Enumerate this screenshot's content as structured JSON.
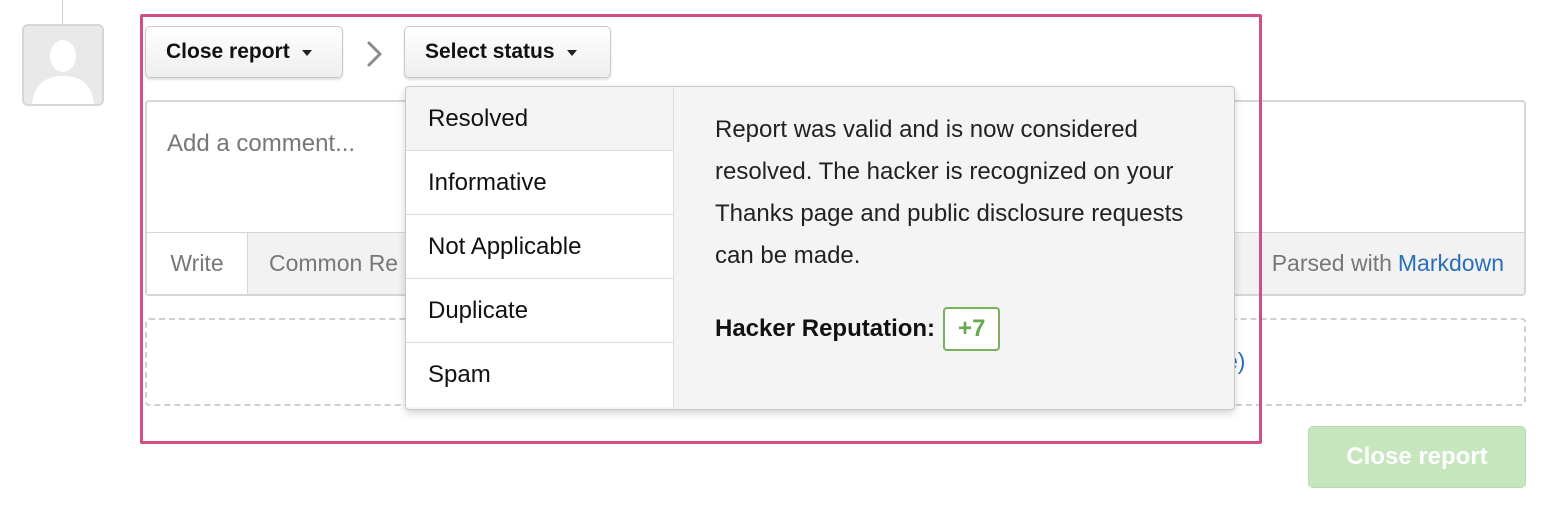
{
  "toolbar": {
    "close_report_dropdown": "Close report",
    "select_status_dropdown": "Select status"
  },
  "comment": {
    "placeholder": "Add a comment...",
    "tabs": {
      "write": "Write",
      "common_responses": "Common Re"
    },
    "parsed_prefix": "Parsed with",
    "parsed_link": "Markdown"
  },
  "attachments": {
    "visible_fragment": "e)"
  },
  "status_menu": {
    "items": [
      {
        "label": "Resolved",
        "active": true
      },
      {
        "label": "Informative",
        "active": false
      },
      {
        "label": "Not Applicable",
        "active": false
      },
      {
        "label": "Duplicate",
        "active": false
      },
      {
        "label": "Spam",
        "active": false
      }
    ],
    "description": "Report was valid and is now considered resolved. The hacker is recognized on your Thanks page and public disclosure requests can be made.",
    "reputation_label": "Hacker Reputation:",
    "reputation_value": "+7"
  },
  "footer": {
    "close_report_button": "Close report"
  },
  "colors": {
    "highlight": "#d24f86",
    "link": "#2a6ebb",
    "reputation": "#6aa84f",
    "submit_disabled": "#c6e6bd"
  }
}
